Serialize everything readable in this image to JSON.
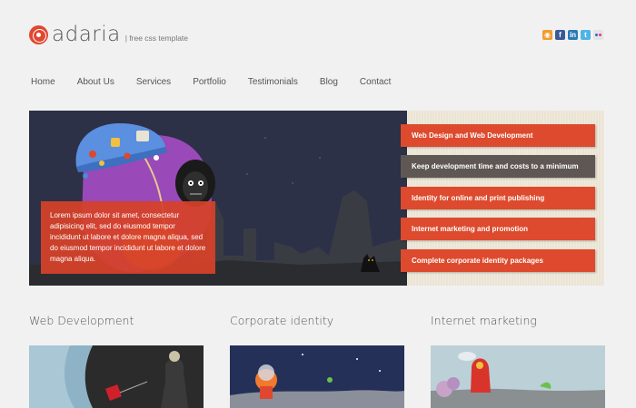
{
  "header": {
    "logo_text": "adaria",
    "tagline": "| free css template",
    "social_icons": [
      "rss-icon",
      "facebook-icon",
      "linkedin-icon",
      "twitter-icon",
      "flickr-icon"
    ]
  },
  "nav": {
    "items": [
      "Home",
      "About Us",
      "Services",
      "Portfolio",
      "Testimonials",
      "Blog",
      "Contact"
    ]
  },
  "banner": {
    "caption": "Lorem ipsum dolor sit amet, consectetur adipisicing elit, sed do eiusmod tempor incididunt ut labore et dolore magna aliqua, sed do eiusmod tempor incididunt ut labore et dolore magna aliqua.",
    "items": [
      {
        "label": "Web Design and Web Development",
        "active": false
      },
      {
        "label": "Keep development time and costs to a minimum",
        "active": true
      },
      {
        "label": "Identity for online and print publishing",
        "active": false
      },
      {
        "label": "Internet marketing and promotion",
        "active": false
      },
      {
        "label": "Complete corporate identity packages",
        "active": false
      }
    ]
  },
  "columns": [
    {
      "title": "Web Development"
    },
    {
      "title": "Corporate identity"
    },
    {
      "title": "Internet marketing"
    }
  ],
  "colors": {
    "accent": "#dd4a2d",
    "active_item": "#5e5754",
    "background": "#f1f1f1"
  }
}
